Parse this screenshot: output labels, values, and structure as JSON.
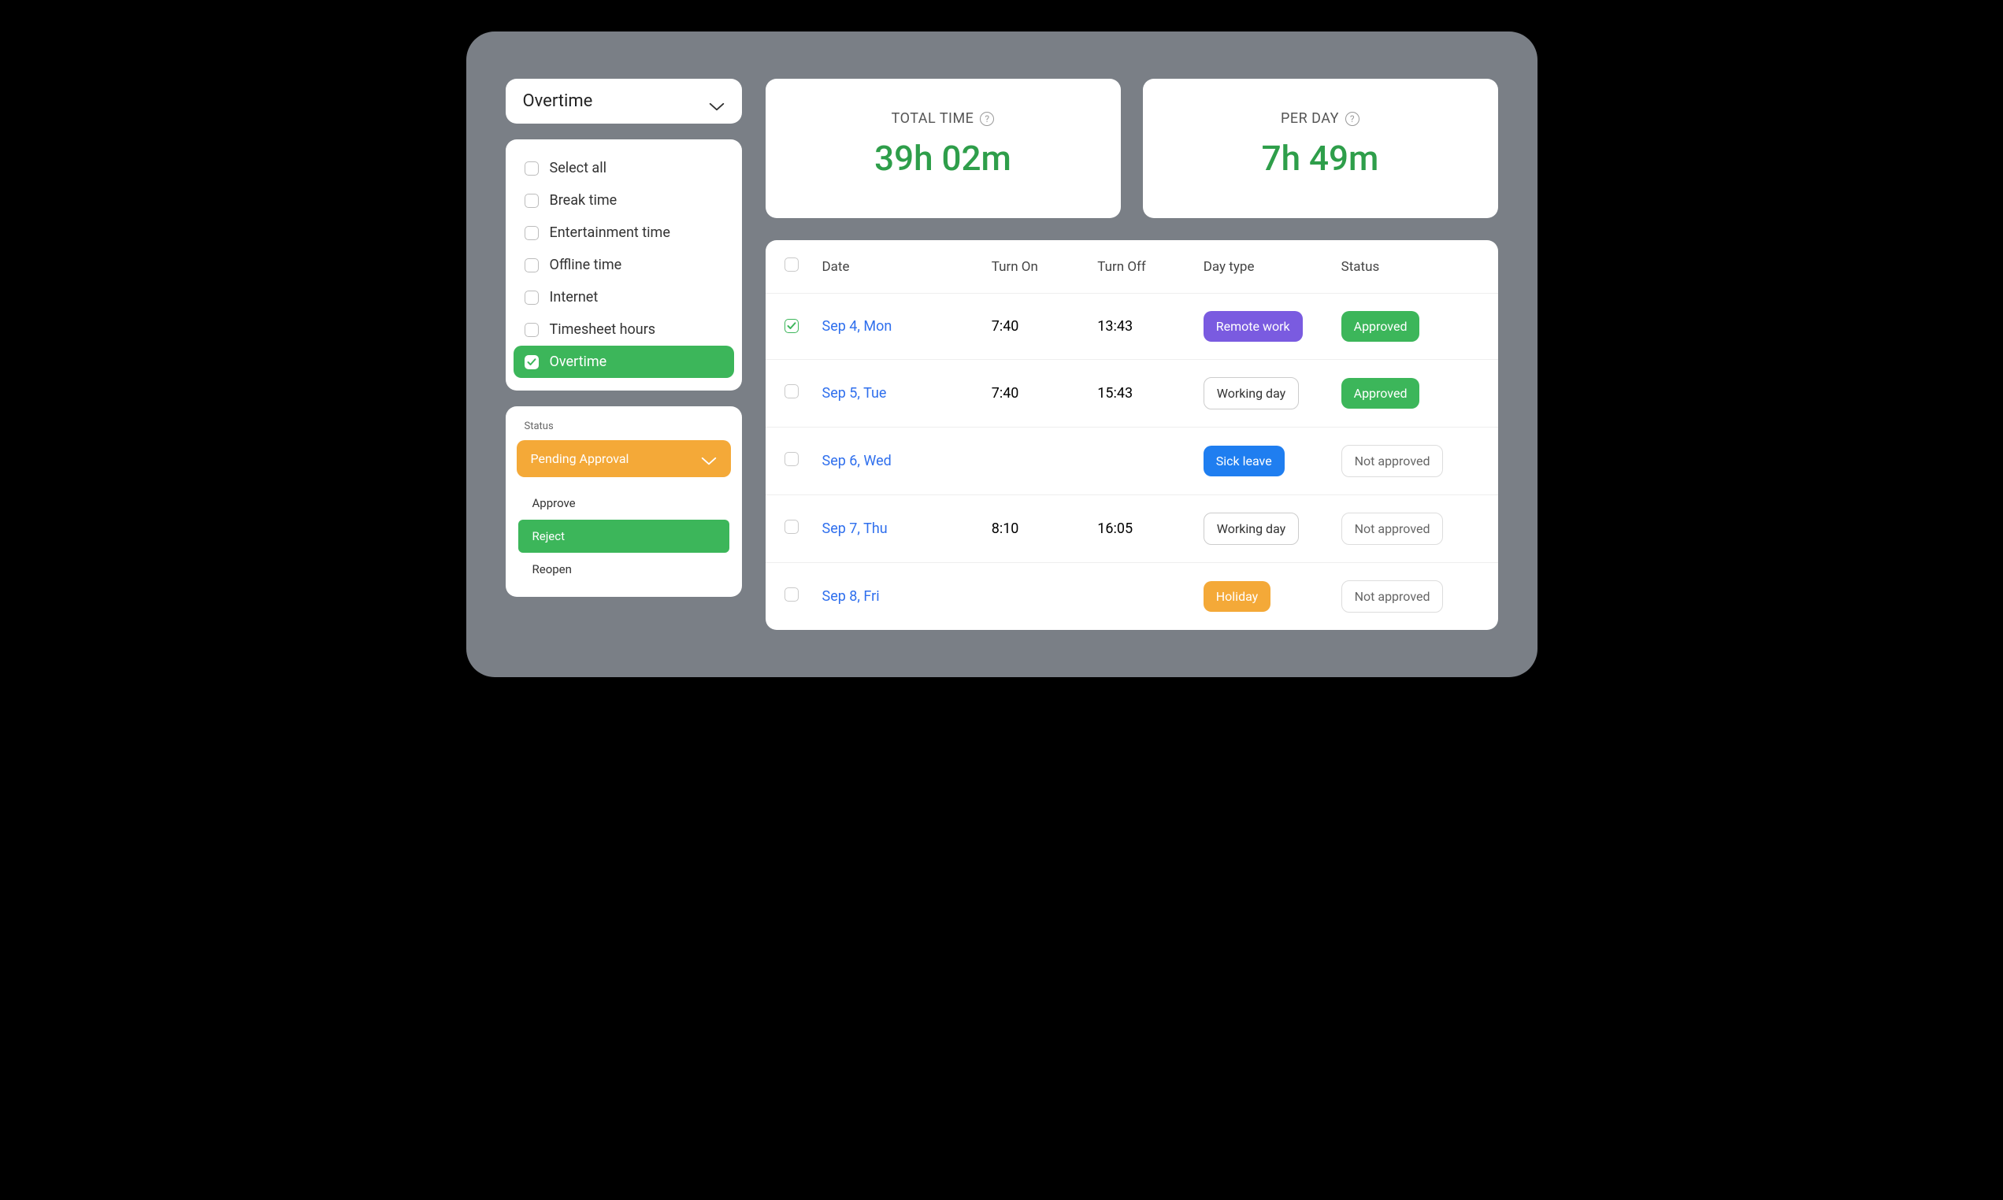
{
  "sidebar": {
    "dropdown_label": "Overtime",
    "filters": [
      {
        "label": "Select all",
        "checked": false
      },
      {
        "label": "Break time",
        "checked": false
      },
      {
        "label": "Entertainment time",
        "checked": false
      },
      {
        "label": "Offline time",
        "checked": false
      },
      {
        "label": "Internet",
        "checked": false
      },
      {
        "label": "Timesheet hours",
        "checked": false
      },
      {
        "label": "Overtime",
        "checked": true
      }
    ],
    "status": {
      "title": "Status",
      "selected": "Pending Approval",
      "options": [
        {
          "label": "Approve",
          "active": false
        },
        {
          "label": "Reject",
          "active": true
        },
        {
          "label": "Reopen",
          "active": false
        }
      ]
    }
  },
  "summary": {
    "total_time": {
      "label": "TOTAL TIME",
      "value": "39h 02m"
    },
    "per_day": {
      "label": "PER DAY",
      "value": "7h 49m"
    }
  },
  "table": {
    "headers": {
      "date": "Date",
      "turn_on": "Turn On",
      "turn_off": "Turn Off",
      "day_type": "Day type",
      "status": "Status"
    },
    "rows": [
      {
        "checked": true,
        "date": "Sep 4, Mon",
        "turn_on": "7:40",
        "turn_off": "13:43",
        "day_type": "Remote work",
        "day_type_style": "remote",
        "status": "Approved",
        "status_style": "approved"
      },
      {
        "checked": false,
        "date": "Sep 5, Tue",
        "turn_on": "7:40",
        "turn_off": "15:43",
        "day_type": "Working day",
        "day_type_style": "outline",
        "status": "Approved",
        "status_style": "approved"
      },
      {
        "checked": false,
        "date": "Sep 6, Wed",
        "turn_on": "",
        "turn_off": "",
        "day_type": "Sick leave",
        "day_type_style": "sick",
        "status": "Not approved",
        "status_style": "notapproved"
      },
      {
        "checked": false,
        "date": "Sep 7, Thu",
        "turn_on": "8:10",
        "turn_off": "16:05",
        "day_type": "Working day",
        "day_type_style": "outline",
        "status": "Not approved",
        "status_style": "notapproved"
      },
      {
        "checked": false,
        "date": "Sep 8, Fri",
        "turn_on": "",
        "turn_off": "",
        "day_type": "Holiday",
        "day_type_style": "holiday",
        "status": "Not approved",
        "status_style": "notapproved"
      }
    ]
  }
}
